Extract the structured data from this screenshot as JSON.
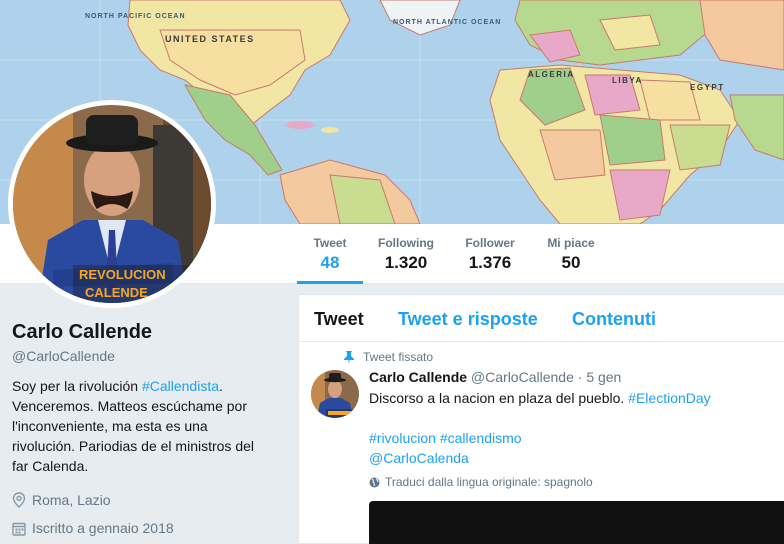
{
  "banner": {
    "map_labels": [
      "NORTH PACIFIC OCEAN",
      "UNITED STATES",
      "NORTH ATLANTIC OCEAN",
      "ALGERIA",
      "LIBYA",
      "EGYPT"
    ]
  },
  "avatar": {
    "overlay_text_1": "REVOLUCION",
    "overlay_text_2": "CALENDE"
  },
  "stats": [
    {
      "label": "Tweet",
      "value": "48"
    },
    {
      "label": "Following",
      "value": "1.320"
    },
    {
      "label": "Follower",
      "value": "1.376"
    },
    {
      "label": "Mi piace",
      "value": "50"
    }
  ],
  "profile": {
    "name": "Carlo Callende",
    "handle": "@CarloCallende",
    "bio_1": "Soy per la rivolución ",
    "bio_hashtag": "#Callendista",
    "bio_2": ". Venceremos. Matteos escúchame por l'inconveniente, ma esta es una rivolución. Pariodias de el ministros del far Calenda.",
    "location": "Roma, Lazio",
    "joined": "Iscritto a gennaio 2018"
  },
  "timeline": {
    "tabs": [
      "Tweet",
      "Tweet e risposte",
      "Contenuti"
    ],
    "pinned_label": "Tweet fissato",
    "tweet": {
      "name": "Carlo Callende",
      "handle": "@CarloCallende",
      "sep": " · ",
      "date": "5 gen",
      "text_1": "Discorso a la nacion en plaza del pueblo. ",
      "hashtag_1": "#ElectionDay",
      "hashtag_2": "#rivolucion",
      "hashtag_3": "#callendismo",
      "mention": "@CarloCalenda",
      "translate": "Traduci dalla lingua originale: spagnolo"
    }
  },
  "colors": {
    "accent": "#1da1f2",
    "text": "#14171a",
    "muted": "#657786",
    "background": "#e6ecf0"
  }
}
